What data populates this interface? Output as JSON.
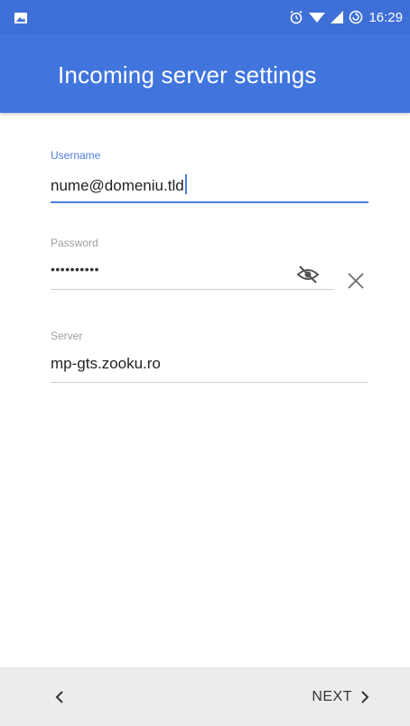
{
  "status_bar": {
    "time": "16:29",
    "icons": [
      "image-notification-icon",
      "alarm-icon",
      "wifi-icon",
      "signal-icon",
      "sync-icon"
    ]
  },
  "header": {
    "title": "Incoming server settings"
  },
  "form": {
    "username": {
      "label": "Username",
      "value": "nume@domeniu.tld"
    },
    "password": {
      "label": "Password",
      "value": "••••••••••"
    },
    "server": {
      "label": "Server",
      "value": "mp-gts.zooku.ro"
    }
  },
  "footer": {
    "back_icon": "chevron-left-icon",
    "next_label": "NEXT"
  },
  "colors": {
    "status_bar": "#3e6fd6",
    "app_bar": "#4175dd",
    "accent": "#4d7ddf",
    "bottom_bar": "#ececec"
  }
}
